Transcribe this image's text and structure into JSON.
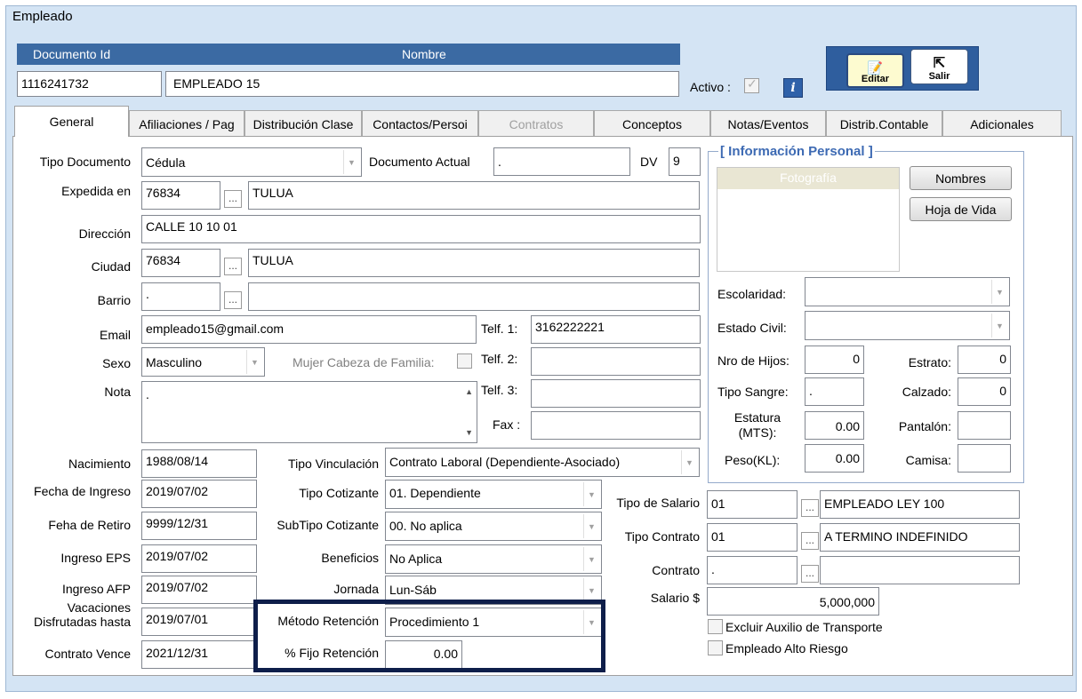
{
  "window": {
    "title": "Empleado"
  },
  "header": {
    "col_doc": "Documento Id",
    "col_nombre": "Nombre",
    "doc_id": "1116241732",
    "nombre": "EMPLEADO 15",
    "activo_label": "Activo :",
    "info_icon": "i"
  },
  "toolbar": {
    "editar": "Editar",
    "salir": "Salir"
  },
  "tabs": [
    {
      "label": "General"
    },
    {
      "label": "Afiliaciones / Pag"
    },
    {
      "label": "Distribución Clase"
    },
    {
      "label": "Contactos/Persoi"
    },
    {
      "label": "Contratos"
    },
    {
      "label": "Conceptos"
    },
    {
      "label": "Notas/Eventos"
    },
    {
      "label": "Distrib.Contable"
    },
    {
      "label": "Adicionales"
    }
  ],
  "general": {
    "tipo_documento_label": "Tipo Documento",
    "tipo_documento": "Cédula",
    "documento_actual_label": "Documento Actual",
    "documento_actual": ".",
    "dv_label": "DV",
    "dv": "9",
    "expedida_label": "Expedida en",
    "expedida_code": "76834",
    "expedida_name": "TULUA",
    "direccion_label": "Dirección",
    "direccion": "CALLE 10 10 01",
    "ciudad_label": "Ciudad",
    "ciudad_code": "76834",
    "ciudad_name": "TULUA",
    "barrio_label": "Barrio",
    "barrio_code": ".",
    "barrio_name": "",
    "email_label": "Email",
    "email": "empleado15@gmail.com",
    "telf1_label": "Telf. 1:",
    "telf1": "3162222221",
    "sexo_label": "Sexo",
    "sexo": "Masculino",
    "mujer_cabeza_label": "Mujer Cabeza de Familia:",
    "telf2_label": "Telf. 2:",
    "telf2": "",
    "nota_label": "Nota",
    "nota": ".",
    "telf3_label": "Telf. 3:",
    "telf3": "",
    "fax_label": "Fax :",
    "fax": "",
    "ellipsis": "...",
    "nacimiento_label": "Nacimiento",
    "nacimiento": "1988/08/14",
    "fecha_ingreso_label": "Fecha de Ingreso",
    "fecha_ingreso": "2019/07/02",
    "fecha_retiro_label": "Feha de Retiro",
    "fecha_retiro": "9999/12/31",
    "ingreso_eps_label": "Ingreso EPS",
    "ingreso_eps": "2019/07/02",
    "ingreso_afp_label": "Ingreso AFP",
    "ingreso_afp": "2019/07/02",
    "vacaciones_label_1": "Vacaciones",
    "vacaciones_label_2": "Disfrutadas hasta",
    "vacaciones": "2019/07/01",
    "contrato_vence_label": "Contrato Vence",
    "contrato_vence": "2021/12/31",
    "tipo_vinculacion_label": "Tipo Vinculación",
    "tipo_vinculacion": "Contrato Laboral (Dependiente-Asociado)",
    "tipo_cotizante_label": "Tipo Cotizante",
    "tipo_cotizante": "01. Dependiente",
    "subtipo_cotizante_label": "SubTipo Cotizante",
    "subtipo_cotizante": "00. No aplica",
    "beneficios_label": "Beneficios",
    "beneficios": "No Aplica",
    "jornada_label": "Jornada",
    "jornada": "Lun-Sáb",
    "metodo_retencion_label": "Método Retención",
    "metodo_retencion": "Procedimiento 1",
    "fijo_retencion_label": "% Fijo Retención",
    "fijo_retencion": "0.00",
    "tipo_salario_label": "Tipo de Salario",
    "tipo_salario_code": "01",
    "tipo_salario_name": "EMPLEADO LEY 100",
    "tipo_contrato_label": "Tipo Contrato",
    "tipo_contrato_code": "01",
    "tipo_contrato_name": "A TERMINO INDEFINIDO",
    "contrato_label": "Contrato",
    "contrato_code": ".",
    "contrato_name": "",
    "salario_label": "Salario $",
    "salario": "5,000,000",
    "excluir_auxilio_label": "Excluir Auxilio de Transporte",
    "alto_riesgo_label": "Empleado Alto Riesgo"
  },
  "personal": {
    "group_title": "[ Información Personal ]",
    "fotografia": "Fotografía",
    "nombres_btn": "Nombres",
    "hoja_vida_btn": "Hoja de Vida",
    "escolaridad_label": "Escolaridad:",
    "escolaridad": "",
    "estado_civil_label": "Estado Civil:",
    "estado_civil": "",
    "nro_hijos_label": "Nro de Hijos:",
    "nro_hijos": "0",
    "estrato_label": "Estrato:",
    "estrato": "0",
    "tipo_sangre_label": "Tipo Sangre:",
    "tipo_sangre": ".",
    "calzado_label": "Calzado:",
    "calzado": "0",
    "estatura_label_1": "Estatura",
    "estatura_label_2": "(MTS):",
    "estatura": "0.00",
    "pantalon_label": "Pantalón:",
    "pantalon": "",
    "peso_label": "Peso(KL):",
    "peso": "0.00",
    "camisa_label": "Camisa:",
    "camisa": ""
  }
}
